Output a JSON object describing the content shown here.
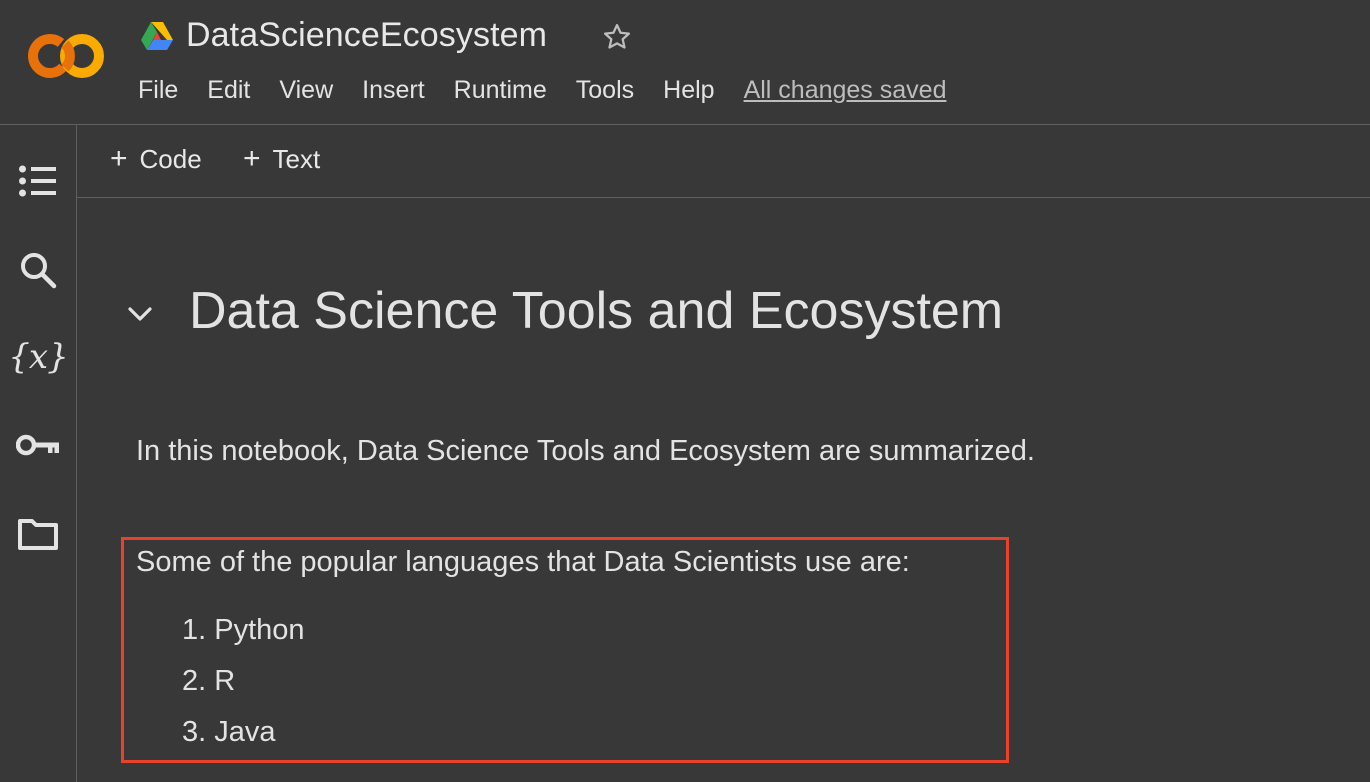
{
  "header": {
    "title": "DataScienceEcosystem",
    "menu": [
      "File",
      "Edit",
      "View",
      "Insert",
      "Runtime",
      "Tools",
      "Help"
    ],
    "save_status": "All changes saved"
  },
  "toolbar": {
    "add_code_label": "Code",
    "add_text_label": "Text"
  },
  "rail": {
    "icons": [
      "table-of-contents-icon",
      "search-icon",
      "variables-icon",
      "secrets-key-icon",
      "files-folder-icon"
    ],
    "variables_glyph": "{x}"
  },
  "notebook": {
    "heading": "Data Science Tools and Ecosystem",
    "intro": "In this notebook, Data Science Tools and Ecosystem are summarized.",
    "languages_intro": "Some of the popular languages that Data Scientists use are:",
    "languages": [
      "1. Python",
      "2. R",
      "3. Java"
    ]
  },
  "colors": {
    "background": "#383838",
    "divider": "#5f5f5f",
    "highlight_border": "#e8412c",
    "logo_orange": "#f9ab00",
    "logo_dark_orange": "#e8710a"
  }
}
